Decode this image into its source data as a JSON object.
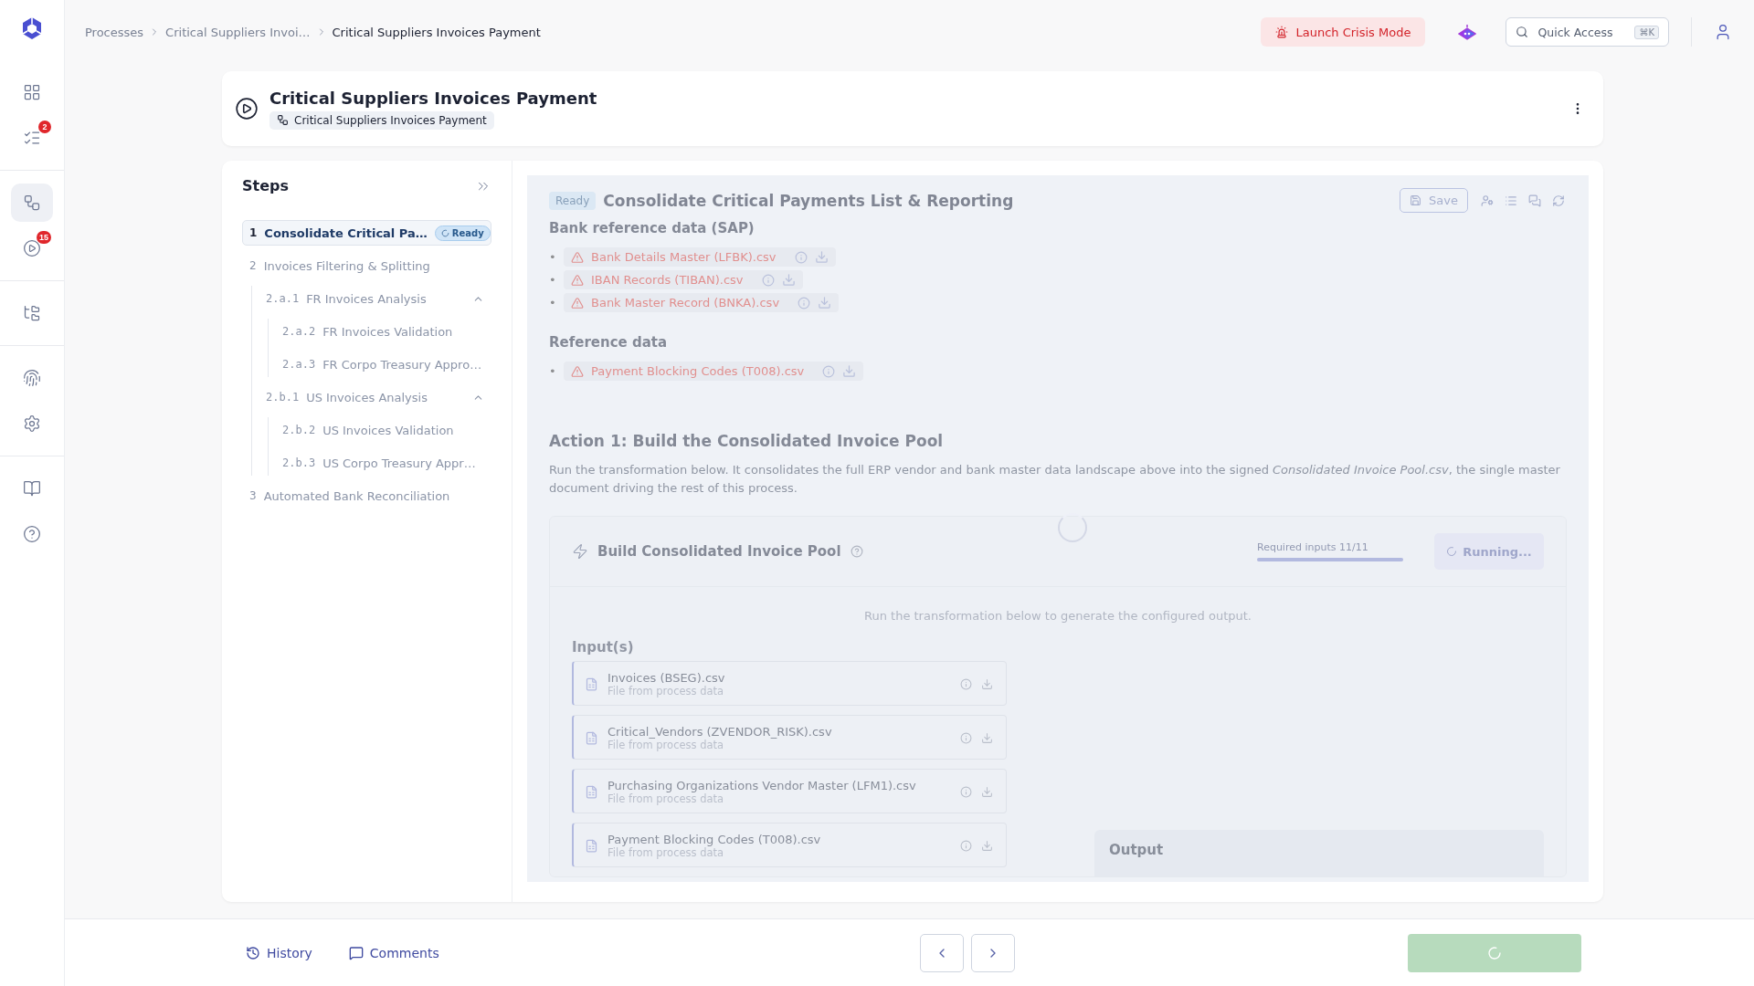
{
  "sidebar": {
    "groups": [
      {
        "items": [
          {
            "kind": "grid",
            "selected": false
          },
          {
            "kind": "tasks",
            "selected": false,
            "badge": "2"
          }
        ]
      },
      {
        "items": [
          {
            "kind": "workflow",
            "selected": true
          },
          {
            "kind": "play",
            "selected": false,
            "badge": "15"
          }
        ]
      },
      {
        "items": [
          {
            "kind": "folders",
            "selected": false
          }
        ]
      },
      {
        "items": [
          {
            "kind": "fingerprint",
            "selected": false
          },
          {
            "kind": "settings",
            "selected": false
          }
        ]
      },
      {
        "items": [
          {
            "kind": "book",
            "selected": false
          },
          {
            "kind": "help",
            "selected": false
          }
        ]
      }
    ]
  },
  "breadcrumb": [
    "Processes",
    "Critical Suppliers Invoi…",
    "Critical Suppliers Invoices Payment"
  ],
  "crisis_button": "Launch Crisis Mode",
  "quick_access": {
    "placeholder": "Quick Access",
    "shortcut": "⌘K"
  },
  "process": {
    "title": "Critical Suppliers Invoices Payment",
    "tag": "Critical Suppliers Invoices Payment"
  },
  "steps": {
    "title": "Steps",
    "items": [
      {
        "number": "1",
        "label": "Consolidate Critical Pa…",
        "selected": true,
        "status": "Ready"
      },
      {
        "number": "2",
        "label": "Invoices Filtering & Splitting",
        "selected": false,
        "children": [
          {
            "number": "2.a.1",
            "label": "FR Invoices Analysis",
            "selected": false,
            "expanded": true,
            "children": [
              {
                "number": "2.a.2",
                "label": "FR Invoices Validation",
                "selected": false
              },
              {
                "number": "2.a.3",
                "label": "FR Corpo Treasury Appro…",
                "selected": false
              }
            ]
          },
          {
            "number": "2.b.1",
            "label": "US Invoices Analysis",
            "selected": false,
            "expanded": true,
            "children": [
              {
                "number": "2.b.2",
                "label": "US Invoices Validation",
                "selected": false
              },
              {
                "number": "2.b.3",
                "label": "US Corpo Treasury Appr…",
                "selected": false
              }
            ]
          }
        ]
      },
      {
        "number": "3",
        "label": "Automated Bank Reconciliation",
        "selected": false
      }
    ]
  },
  "step_view": {
    "status": "Ready",
    "title": "Consolidate Critical Payments List & Reporting",
    "save": "Save",
    "loading": true,
    "sections": [
      {
        "heading": "Bank reference data (SAP)",
        "files": [
          {
            "bullet": "•",
            "name": "Bank Details Master (LFBK).csv",
            "missing": true
          },
          {
            "bullet": "•",
            "name": "IBAN Records (TIBAN).csv",
            "missing": true
          },
          {
            "bullet": "•",
            "name": "Bank Master Record (BNKA).csv",
            "missing": true
          }
        ]
      },
      {
        "heading": "Reference data",
        "files": [
          {
            "bullet": "•",
            "name": "Payment Blocking Codes (T008).csv",
            "missing": true
          }
        ]
      }
    ],
    "action": {
      "heading": "Action 1: Build the Consolidated Invoice Pool",
      "text": "Run the transformation below. It consolidates the full ERP vendor and bank master data landscape above into the signed *Consolidated Invoice Pool.csv*, the single master document driving the rest of this process."
    },
    "transform": {
      "title": "Build Consolidated Invoice Pool",
      "requirement": "Required inputs 11/11",
      "level": 1,
      "run_button": "Running...",
      "hint": "Run the transformation below to generate the configured output.",
      "inputs_heading": "Input(s)",
      "inputs": [
        {
          "name": "Invoices (BSEG).csv",
          "source": "File from process data"
        },
        {
          "name": "Critical_Vendors (ZVENDOR_RISK).csv",
          "source": "File from process data"
        },
        {
          "name": "Purchasing Organizations Vendor Master (LFM1).csv",
          "source": "File from process data"
        },
        {
          "name": "Payment Blocking Codes (T008).csv",
          "source": "File from process data"
        }
      ],
      "output_heading": "Output"
    }
  },
  "footer": {
    "history": "History",
    "comments": "Comments",
    "submitting": true
  }
}
